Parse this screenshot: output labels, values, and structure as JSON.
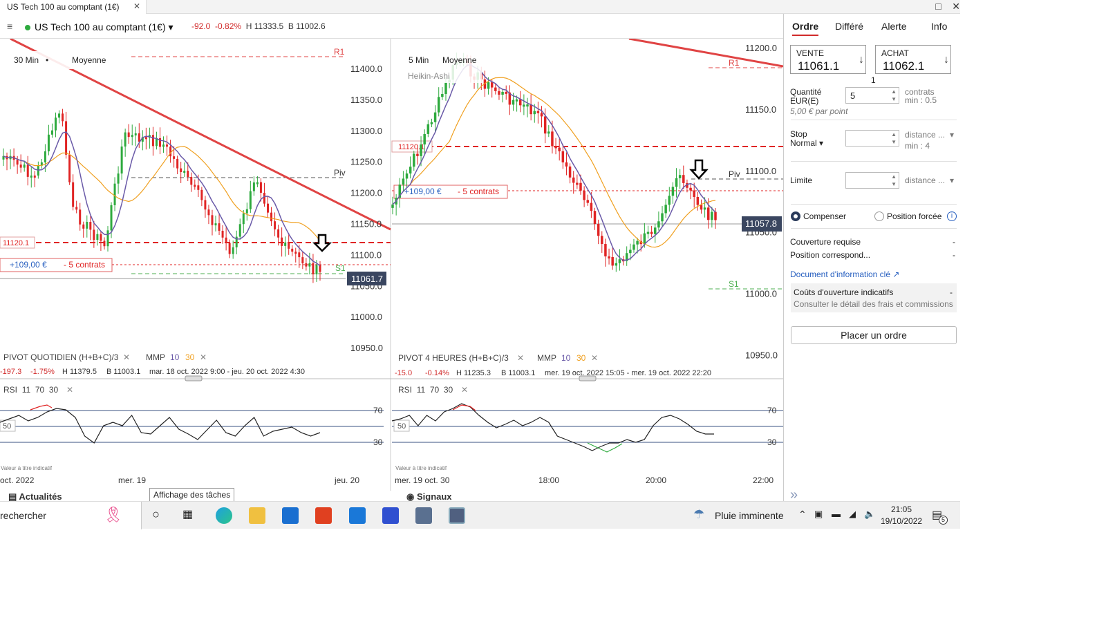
{
  "window": {
    "tab_title": "US Tech 100 au comptant (1€)",
    "tab_close": "✕",
    "maximize_icon": "□",
    "close_icon": "✕"
  },
  "header": {
    "menu_icon": "≡",
    "instrument": "US Tech 100 au comptant (1€)",
    "dropdown_icon": "▾",
    "change": "-92.0",
    "change_pct": "-0.82%",
    "high": "H 11333.5",
    "low": "B 11002.6"
  },
  "left_chart": {
    "timeframe": "30 Min",
    "mode": "Moyenne",
    "y_ticks": [
      "11400.0",
      "11350.0",
      "11300.0",
      "11250.0",
      "11200.0",
      "11150.0",
      "11100.0",
      "11050.0",
      "11000.0",
      "10950.0"
    ],
    "levels": {
      "r1": "R1",
      "piv": "Piv",
      "s1": "S1"
    },
    "order_line_label": "11120.1",
    "position_pnl": "+109,00 €",
    "position_qty": "- 5 contrats",
    "last_price": "11061.7",
    "indicator_pivot": "PIVOT  QUOTIDIEN  (H+B+C)/3",
    "indicator_mmp": "MMP",
    "mmp_fast": "10",
    "mmp_slow": "30",
    "stats_change": "-197.3",
    "stats_pct": "-1.75%",
    "stats_high": "H 11379.5",
    "stats_low": "B 11003.1",
    "stats_range": "mar. 18 oct. 2022 9:00 - jeu. 20 oct. 2022 4:30",
    "rsi_label": "RSI",
    "rsi_params": [
      "11",
      "70",
      "30"
    ],
    "rsi_levels": [
      "70",
      "50",
      "30"
    ],
    "disclaimer": "Valeur à titre indicatif",
    "x_ticks": [
      "oct. 2022",
      "mer. 19",
      "jeu. 20"
    ]
  },
  "right_chart": {
    "timeframe": "5 Min",
    "mode": "Moyenne",
    "sub_mode": "Heikin-Ashi",
    "y_ticks": [
      "11200.0",
      "11150.0",
      "11100.0",
      "11050.0",
      "11000.0",
      "10950.0"
    ],
    "levels": {
      "r1": "R1",
      "piv": "Piv",
      "s1": "S1"
    },
    "order_line_label": "11120.1",
    "position_pnl": "+109,00 €",
    "position_qty": "- 5 contrats",
    "last_price": "11057.8",
    "indicator_pivot": "PIVOT  4 HEURES  (H+B+C)/3",
    "indicator_mmp": "MMP",
    "mmp_fast": "10",
    "mmp_slow": "30",
    "stats_change": "-15.0",
    "stats_pct": "-0.14%",
    "stats_high": "H 11235.3",
    "stats_low": "B 11003.1",
    "stats_range": "mer. 19 oct. 2022 15:05 - mer. 19 oct. 2022 22:20",
    "rsi_label": "RSI",
    "rsi_params": [
      "11",
      "70",
      "30"
    ],
    "rsi_levels": [
      "70",
      "50",
      "30"
    ],
    "disclaimer": "Valeur à titre indicatif",
    "x_ticks": [
      "mer. 19 oct. 30",
      "18:00",
      "20:00",
      "22:00"
    ]
  },
  "bottom_tabs": {
    "actualites": "Actualités",
    "signaux": "Signaux",
    "tooltip": "Affichage des tâches",
    "expand_icon": "»"
  },
  "side_panel": {
    "tabs": [
      "Ordre",
      "Différé",
      "Alerte",
      "Info"
    ],
    "sell_label": "VENTE",
    "sell_price": "11061.1",
    "buy_label": "ACHAT",
    "buy_price": "11062.1",
    "spread": "1",
    "qty_label": "Quantité",
    "qty_currency": "EUR(E)",
    "qty_value": "5",
    "qty_unit": "contrats",
    "qty_min": "min : 0.5",
    "per_point": "5,00 € par point",
    "stop_label": "Stop",
    "stop_type": "Normal",
    "stop_distance": "distance ...",
    "stop_min": "min : 4",
    "limit_label": "Limite",
    "limit_distance": "distance ...",
    "radio_compensate": "Compenser",
    "radio_forced": "Position forcée",
    "coverage_label": "Couverture requise",
    "coverage_value": "-",
    "position_label": "Position correspond...",
    "position_value": "-",
    "doc_link": "Document d'information clé",
    "costs_label": "Coûts d'ouverture indicatifs",
    "costs_value": "-",
    "costs_link": "Consulter le détail des frais et commissions",
    "place_order": "Placer un ordre"
  },
  "taskbar": {
    "search": "rechercher",
    "weather": "Pluie imminente",
    "time": "21:05",
    "date": "19/10/2022",
    "notif_count": "5"
  },
  "colors": {
    "bull": "#2eaa3e",
    "bear": "#e02424",
    "ma_fast": "#6a5aa8",
    "ma_slow": "#f0a020",
    "trend": "#e04444",
    "accent": "#d12a2a"
  }
}
